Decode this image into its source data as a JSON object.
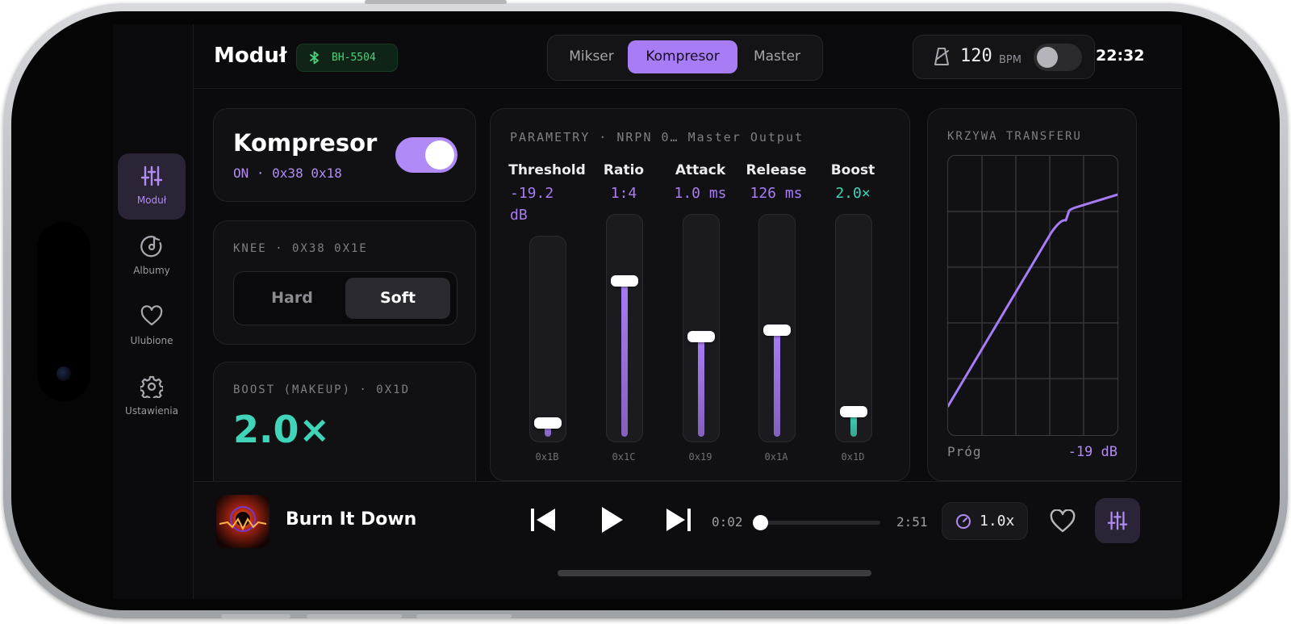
{
  "app": {
    "title": "Moduł",
    "device_badge": "BH-5504",
    "clock": "22:32"
  },
  "tabs": [
    {
      "label": "Mikser",
      "active": false
    },
    {
      "label": "Kompresor",
      "active": true
    },
    {
      "label": "Master",
      "active": false
    }
  ],
  "tempo": {
    "value": "120",
    "unit": "BPM",
    "toggle_on": false
  },
  "sidebar": {
    "items": [
      {
        "label": "Moduł",
        "icon": "sliders-icon",
        "active": true
      },
      {
        "label": "Albumy",
        "icon": "disc-icon",
        "active": false
      },
      {
        "label": "Ulubione",
        "icon": "heart-icon",
        "active": false
      },
      {
        "label": "Ustawienia",
        "icon": "gear-icon",
        "active": false
      }
    ]
  },
  "compressor": {
    "title": "Kompresor",
    "status": "ON · 0x38 0x18",
    "enabled": true
  },
  "knee": {
    "caption": "KNEE · 0X38 0X1E",
    "options": [
      {
        "label": "Hard",
        "selected": false
      },
      {
        "label": "Soft",
        "selected": true
      }
    ]
  },
  "boost_card": {
    "caption": "BOOST (MAKEUP) · 0X1D",
    "value": "2.0×"
  },
  "parameters": {
    "caption": "PARAMETRY · NRPN 0…  Master Output",
    "sliders": [
      {
        "label": "Threshold",
        "value_line1": "-19.2",
        "value_line2": "dB",
        "code": "0x1B",
        "level": 0.04,
        "color": "#a77cf5"
      },
      {
        "label": "Ratio",
        "value_line1": "1:4",
        "value_line2": "",
        "code": "0x1C",
        "level": 0.74,
        "color": "#a77cf5"
      },
      {
        "label": "Attack",
        "value_line1": "1.0 ms",
        "value_line2": "",
        "code": "0x19",
        "level": 0.47,
        "color": "#a77cf5"
      },
      {
        "label": "Release",
        "value_line1": "126 ms",
        "value_line2": "",
        "code": "0x1A",
        "level": 0.5,
        "color": "#a77cf5"
      },
      {
        "label": "Boost",
        "value_line1": "2.0×",
        "value_line2": "",
        "code": "0x1D",
        "level": 0.11,
        "color": "#40d5b8"
      }
    ]
  },
  "transfer": {
    "caption": "KRZYWA TRANSFERU",
    "threshold_label": "Próg",
    "threshold_value": "-19 dB"
  },
  "player": {
    "title": "Burn It Down",
    "elapsed": "0:02",
    "duration": "2:51",
    "progress": 0.012,
    "speed": "1.0x"
  },
  "colors": {
    "accent": "#a77cf5",
    "teal": "#40d5b8",
    "bluetooth_green": "#4cd07d"
  }
}
